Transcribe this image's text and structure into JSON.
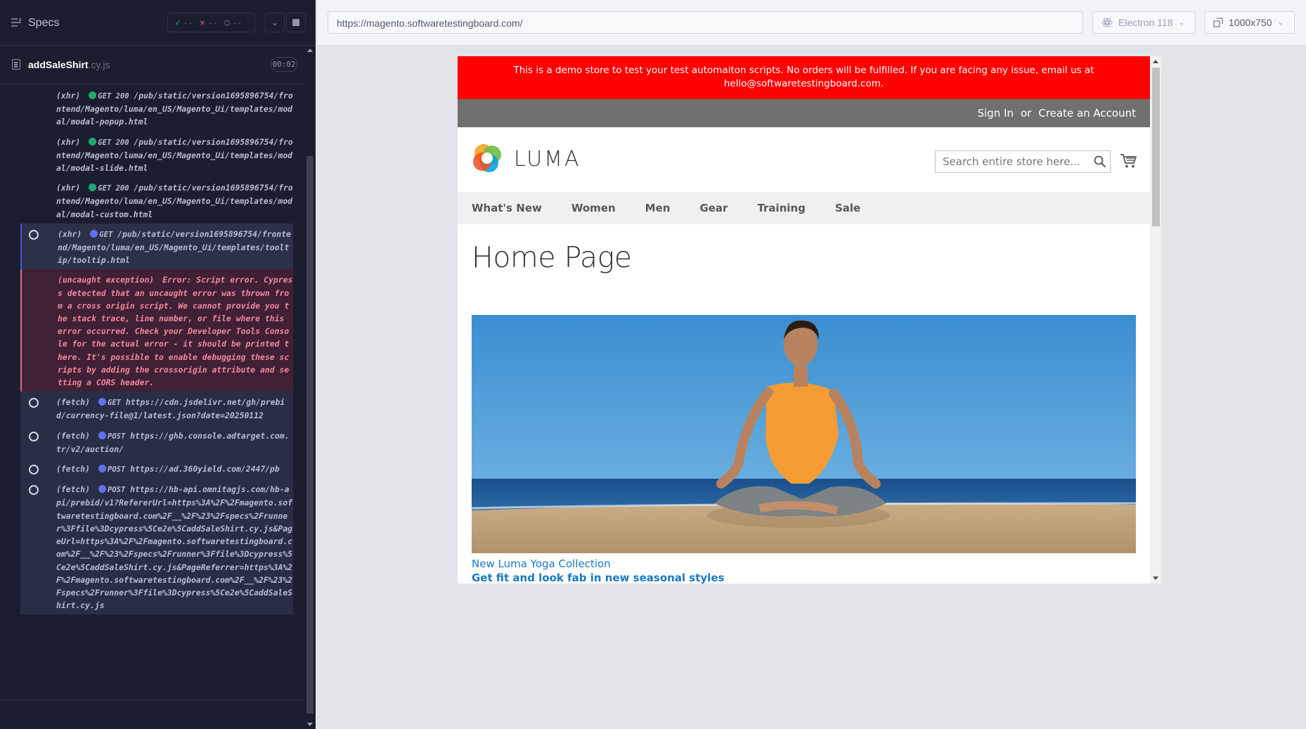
{
  "reporter": {
    "header": {
      "title": "Specs",
      "passed": "--",
      "failed": "--",
      "pending": "--"
    },
    "spec": {
      "name": "addSaleShirt",
      "ext": ".cy.js",
      "time": "00:02"
    },
    "commands": [
      {
        "kind": "(xhr)",
        "status": "GET 200",
        "dot": "green",
        "url": "/pub/static/version1695896754/frontend/Magento/luma/en_US/Magento_Ui/templates/modal/modal-popup.html",
        "style": "normal"
      },
      {
        "kind": "(xhr)",
        "status": "GET 200",
        "dot": "green",
        "url": "/pub/static/version1695896754/frontend/Magento/luma/en_US/Magento_Ui/templates/modal/modal-slide.html",
        "style": "normal"
      },
      {
        "kind": "(xhr)",
        "status": "GET 200",
        "dot": "green",
        "url": "/pub/static/version1695896754/frontend/Magento/luma/en_US/Magento_Ui/templates/modal/modal-custom.html",
        "style": "normal"
      },
      {
        "kind": "(xhr)",
        "status": "GET",
        "dot": "blue",
        "url": "/pub/static/version1695896754/frontend/Magento/luma/en_US/Magento_Ui/templates/tooltip/tooltip.html",
        "style": "hl"
      },
      {
        "kind": "(uncaught exception)",
        "status": "",
        "dot": "",
        "url": "Error: Script error. Cypress detected that an uncaught error was thrown from a cross origin script. We cannot provide you the stack trace, line number, or file where this error occurred. Check your Developer Tools Console for the actual error - it should be printed there. It's possible to enable debugging these scripts by adding the crossorigin attribute and setting a CORS header.",
        "style": "err"
      },
      {
        "kind": "(fetch)",
        "status": "GET",
        "dot": "blue",
        "url": "https://cdn.jsdelivr.net/gh/prebid/currency-file@1/latest.json?date=20250112",
        "style": "pend"
      },
      {
        "kind": "(fetch)",
        "status": "POST",
        "dot": "blue",
        "url": "https://ghb.console.adtarget.com.tr/v2/auction/",
        "style": "pend"
      },
      {
        "kind": "(fetch)",
        "status": "POST",
        "dot": "blue",
        "url": "https://ad.360yield.com/2447/pb",
        "style": "pend"
      },
      {
        "kind": "(fetch)",
        "status": "POST",
        "dot": "blue",
        "url": "https://hb-api.omnitagjs.com/hb-api/prebid/v1?RefererUrl=https%3A%2F%2Fmagento.softwaretestingboard.com%2F__%2F%23%2Fspecs%2Frunner%3Ffile%3Dcypress%5Ce2e%5CaddSaleShirt.cy.js&PageUrl=https%3A%2F%2Fmagento.softwaretestingboard.com%2F__%2F%23%2Fspecs%2Frunner%3Ffile%3Dcypress%5Ce2e%5CaddSaleShirt.cy.js&PageReferrer=https%3A%2F%2Fmagento.softwaretestingboard.com%2F__%2F%23%2Fspecs%2Frunner%3Ffile%3Dcypress%5Ce2e%5CaddSaleShirt.cy.js",
        "style": "pend"
      }
    ]
  },
  "topbar": {
    "url": "https://magento.softwaretestingboard.com/",
    "browser": "Electron 118",
    "viewport": "1000x750"
  },
  "aut": {
    "demo_notice_1": "This is a demo store to test your test automaiton scripts. No orders will be fulfilled. If you are facing any issue, email us at",
    "demo_notice_2": "hello@softwaretestingboard.com.",
    "sign_in": "Sign In",
    "or": "or",
    "create_account": "Create an Account",
    "logo_text": "LUMA",
    "search_placeholder": "Search entire store here...",
    "nav": [
      "What's New",
      "Women",
      "Men",
      "Gear",
      "Training",
      "Sale"
    ],
    "page_title": "Home Page",
    "hero_caption_1": "New Luma Yoga Collection",
    "hero_caption_2": "Get fit and look fab in new seasonal styles"
  },
  "colors": {
    "demo_bar": "#ff0101",
    "link": "#1979c3",
    "reporter_bg": "#1b1e2e",
    "error_text": "#f3889a"
  }
}
